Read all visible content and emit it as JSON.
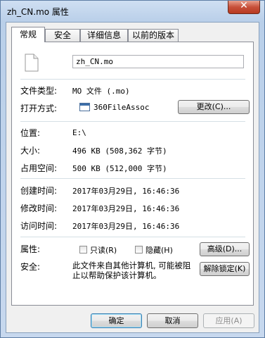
{
  "window": {
    "title": "zh_CN.mo 属性",
    "close_glyph": "✕"
  },
  "tabs": [
    {
      "label": "常规",
      "active": true
    },
    {
      "label": "安全",
      "active": false
    },
    {
      "label": "详细信息",
      "active": false
    },
    {
      "label": "以前的版本",
      "active": false
    }
  ],
  "general": {
    "file_name": "zh_CN.mo",
    "type_label": "文件类型:",
    "type_value": "MO 文件 (.mo)",
    "opens_with_label": "打开方式:",
    "opens_with_value": "360FileAssoc",
    "change_button": "更改(C)...",
    "location_label": "位置:",
    "location_value": "E:\\",
    "size_label": "大小:",
    "size_value": "496 KB (508,362 字节)",
    "size_on_disk_label": "占用空间:",
    "size_on_disk_value": "500 KB (512,000 字节)",
    "created_label": "创建时间:",
    "created_value": "2017年03月29日, 16:46:36",
    "modified_label": "修改时间:",
    "modified_value": "2017年03月29日, 16:46:36",
    "accessed_label": "访问时间:",
    "accessed_value": "2017年03月29日, 16:46:36",
    "attributes_label": "属性:",
    "readonly_label": "只读(R)",
    "readonly_checked": false,
    "hidden_label": "隐藏(H)",
    "hidden_checked": false,
    "advanced_button": "高级(D)...",
    "security_label": "安全:",
    "security_note": "此文件来自其他计算机, 可能被阻止以帮助保护该计算机。",
    "unblock_button": "解除锁定(K)"
  },
  "footer": {
    "ok": "确定",
    "cancel": "取消",
    "apply": "应用(A)"
  },
  "icons": {
    "file": "file-icon",
    "app": "app-window-icon",
    "close": "close-icon"
  },
  "colors": {
    "titlebar": "#c5d7ed",
    "close_button": "#c7503a",
    "separator": "#d5dfe5"
  }
}
